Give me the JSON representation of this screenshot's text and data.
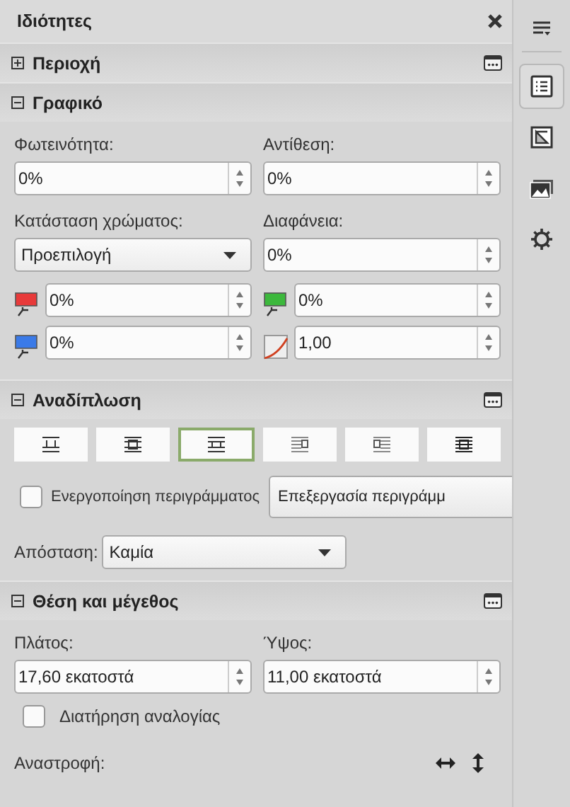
{
  "title": "Ιδιότητες",
  "sections": [
    {
      "title": "Περιοχή",
      "expanded": false,
      "has_options": true
    },
    {
      "kind": "graphic",
      "title": "Γραφικό",
      "expanded": true,
      "has_options": false,
      "brightness": {
        "label": "Φωτεινότητα:",
        "value": "0%"
      },
      "contrast": {
        "label": "Αντίθεση:",
        "value": "0%"
      },
      "color_mode": {
        "label": "Κατάσταση χρώματος:",
        "value": "Προεπιλογή"
      },
      "transparency": {
        "label": "Διαφάνεια:",
        "value": "0%"
      },
      "channels": [
        {
          "kind": "color",
          "color": "#e83a3a",
          "value": "0%"
        },
        {
          "kind": "color",
          "color": "#3cb83c",
          "value": "0%"
        },
        {
          "kind": "color",
          "color": "#3a7ae8",
          "value": "0%"
        },
        {
          "kind": "gamma",
          "value": "1,00"
        }
      ]
    },
    {
      "kind": "wrap",
      "title": "Αναδίπλωση",
      "expanded": true,
      "has_options": true,
      "wrap_modes": [
        {
          "selected": false
        },
        {
          "selected": false
        },
        {
          "selected": true
        },
        {
          "selected": false
        },
        {
          "selected": false
        },
        {
          "selected": false
        }
      ],
      "contour": {
        "label": "Ενεργοποίηση περιγράμματος",
        "checked": false
      },
      "edit_contour": "Επεξεργασία περιγράμμ",
      "spacing": {
        "label": "Απόσταση:",
        "value": "Καμία"
      }
    },
    {
      "kind": "position",
      "title": "Θέση και μέγεθος",
      "expanded": true,
      "has_options": true,
      "width": {
        "label": "Πλάτος:",
        "value": "17,60 εκατοστά"
      },
      "height": {
        "label": "Ύψος:",
        "value": "11,00 εκατοστά"
      },
      "keep_ratio": {
        "label": "Διατήρηση αναλογίας",
        "checked": false
      },
      "flip": {
        "label": "Αναστροφή:"
      }
    }
  ],
  "sidebar_tabs": [
    {
      "selected": true
    },
    {
      "selected": false
    },
    {
      "selected": false
    },
    {
      "selected": false
    }
  ]
}
